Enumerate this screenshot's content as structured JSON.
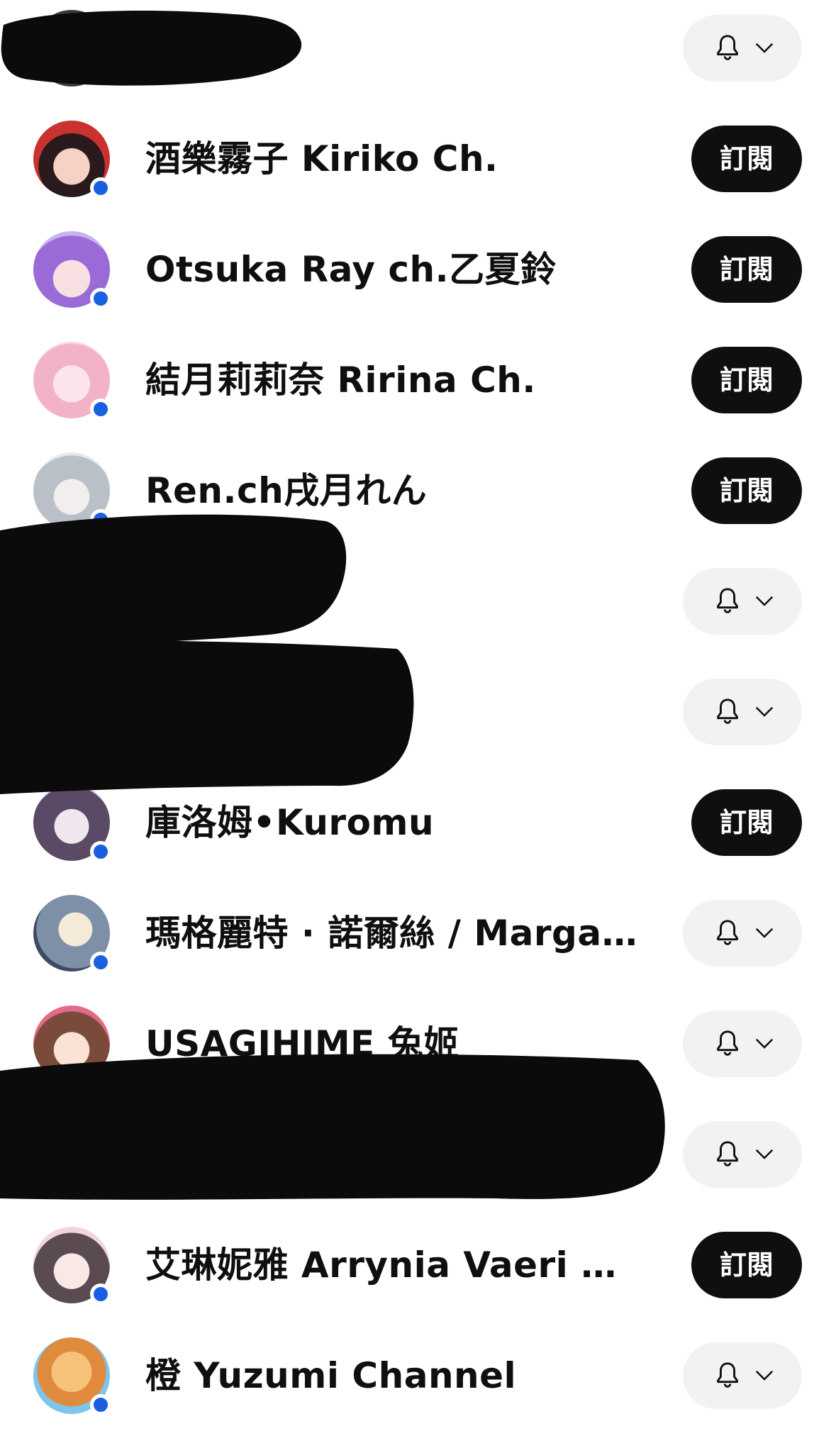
{
  "subscribe_label": "訂閱",
  "accent_colors": {
    "live_dot": "#1a5fe0",
    "subscribe_bg": "#0f0f0f",
    "bell_bg": "#f2f2f2"
  },
  "channels": [
    {
      "name": "",
      "state": "subscribed",
      "redacted": true
    },
    {
      "name": "酒樂霧子 Kiriko Ch.",
      "state": "unsubscribed"
    },
    {
      "name": "Otsuka Ray ch.乙夏鈴",
      "state": "unsubscribed"
    },
    {
      "name": "結月莉莉奈 Ririna Ch.",
      "state": "unsubscribed"
    },
    {
      "name": "Ren.ch戌月れん",
      "state": "unsubscribed"
    },
    {
      "name": "",
      "state": "subscribed",
      "redacted": true
    },
    {
      "name": "",
      "state": "subscribed",
      "redacted": true
    },
    {
      "name": "庫洛姆•Kuromu",
      "state": "unsubscribed"
    },
    {
      "name": "瑪格麗特 · 諾爾絲 / Margar...",
      "state": "subscribed"
    },
    {
      "name": "USAGIHIME 兔姬",
      "state": "subscribed"
    },
    {
      "name": "",
      "state": "subscribed",
      "redacted": true
    },
    {
      "name": "艾琳妮雅 Arrynia Vaeri Ch.",
      "state": "unsubscribed"
    },
    {
      "name": "橙 Yuzumi Channel",
      "state": "subscribed"
    }
  ]
}
